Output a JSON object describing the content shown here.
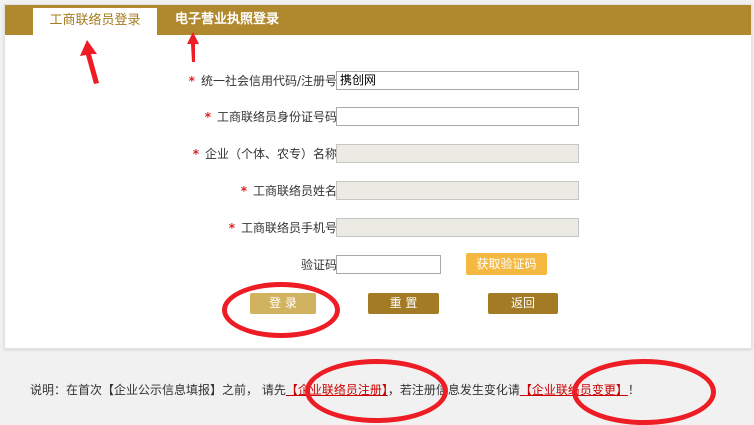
{
  "tabs": [
    {
      "label": "工商联络员登录",
      "active": true
    },
    {
      "label": "电子营业执照登录",
      "active": false
    }
  ],
  "form": {
    "credit_code": {
      "label": "统一社会信用代码/注册号",
      "value": "携创网",
      "required": true
    },
    "id_number": {
      "label": "工商联络员身份证号码",
      "value": "",
      "required": true
    },
    "company_name": {
      "label": "企业（个体、农专）名称",
      "value": "",
      "required": true,
      "disabled": true
    },
    "liaison_name": {
      "label": "工商联络员姓名",
      "value": "",
      "required": true,
      "disabled": true
    },
    "liaison_phone": {
      "label": "工商联络员手机号",
      "value": "",
      "required": true,
      "disabled": true
    },
    "captcha": {
      "label": "验证码",
      "value": ""
    },
    "star": "*",
    "get_code_label": "获取验证码"
  },
  "buttons": {
    "login": "登 录",
    "reset": "重 置",
    "back": "返回"
  },
  "note": {
    "prefix": "说明：在首次【企业公示信息填报】之前， 请先",
    "register_link": "【企业联络员注册】",
    "middle": "，若注册信息发生变化请",
    "change_link": "【企业联络员变更】",
    "suffix": "！"
  },
  "colors": {
    "brand": "#b0882e",
    "active_tab_text": "#a57b1f",
    "get_code_button": "#f5b942",
    "login_button": "#d1b25f",
    "button": "#a27b24",
    "annotation": "#ee1c24"
  }
}
